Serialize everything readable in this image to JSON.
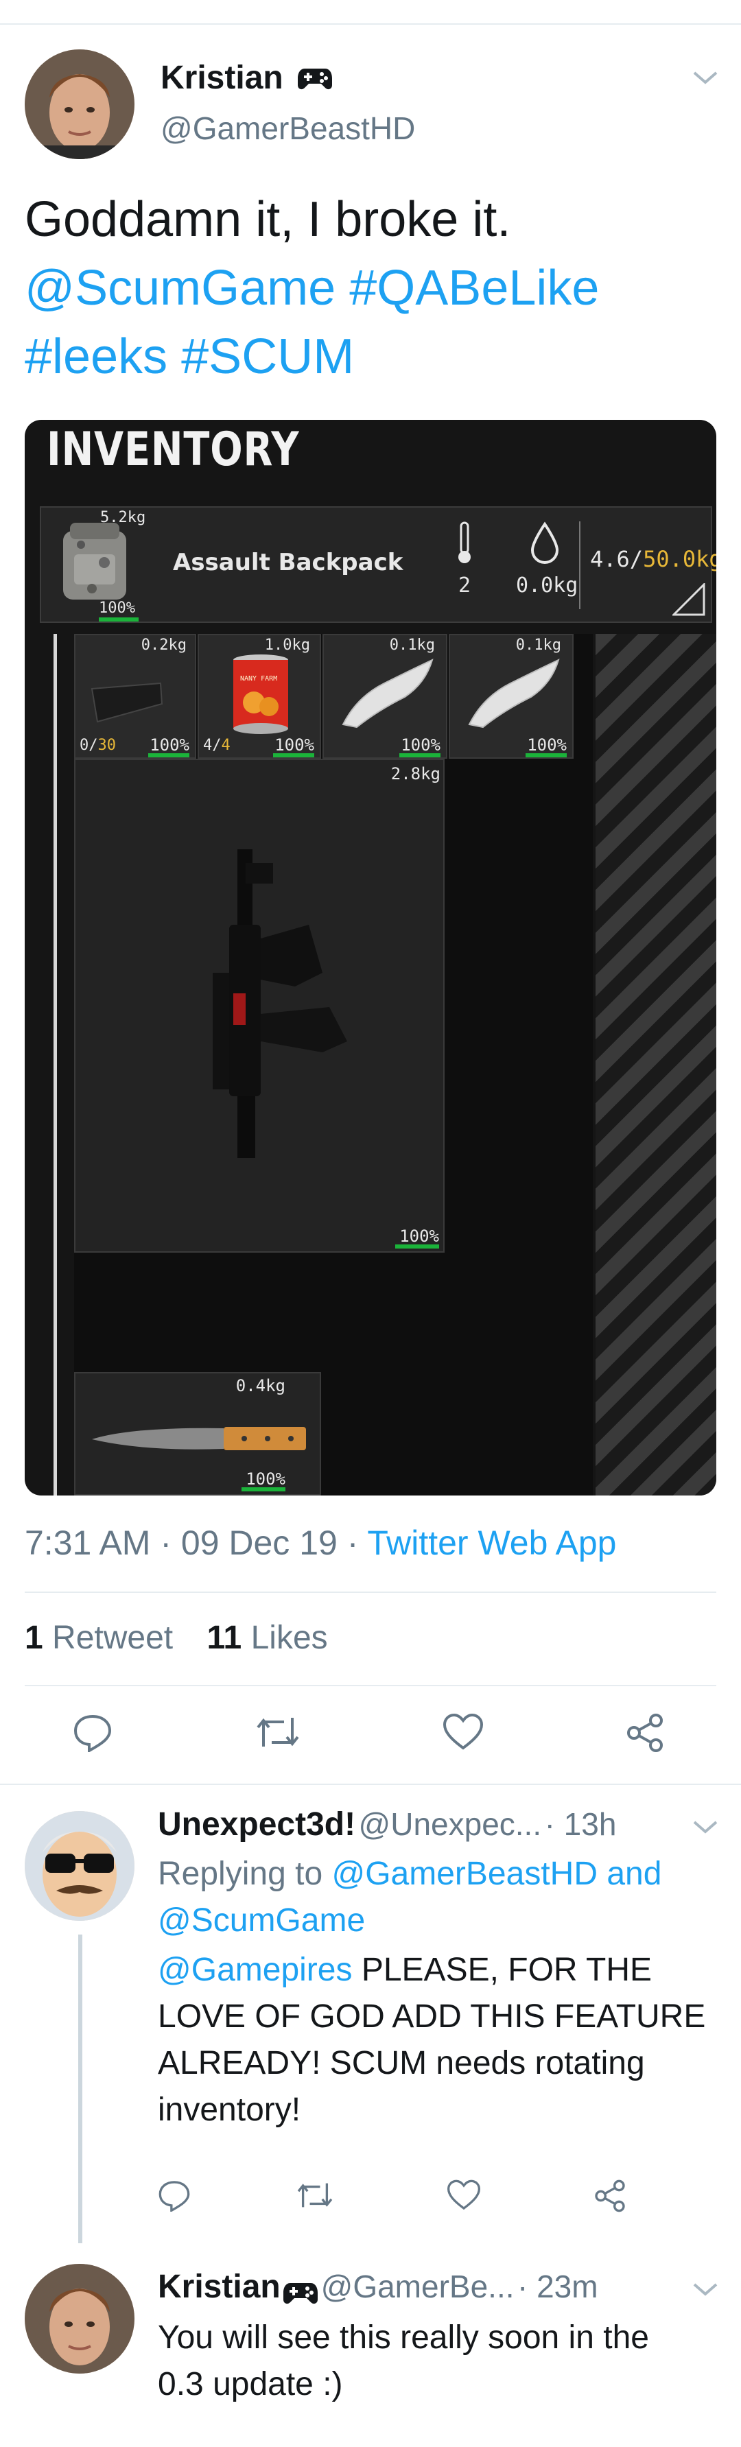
{
  "tweet": {
    "author_name": "Kristian",
    "author_handle": "@GamerBeastHD",
    "text_line1": "Goddamn it, I broke it.",
    "mention": "@ScumGame",
    "hashtag1": "#QABeLike",
    "hashtag2": "#leeks",
    "hashtag3": "#SCUM",
    "time": "7:31 AM · 09 Dec 19 · ",
    "source": "Twitter Web App",
    "retweets_count": "1",
    "retweets_label": "Retweet",
    "likes_count": "11",
    "likes_label": "Likes"
  },
  "game": {
    "title": "INVENTORY",
    "backpack": {
      "weight": "5.2kg",
      "condition": "100%",
      "name": "Assault Backpack",
      "temperature": "2",
      "water": "0.0kg",
      "capacity_used": "4.6",
      "capacity_max": "50.0kg"
    },
    "slots": [
      {
        "weight": "0.2kg",
        "left": "0",
        "left2": "30",
        "cond": "100%"
      },
      {
        "weight": "1.0kg",
        "left": "4",
        "left2": "4",
        "cond": "100%"
      },
      {
        "weight": "0.1kg",
        "cond": "100%"
      },
      {
        "weight": "0.1kg",
        "cond": "100%"
      }
    ],
    "weapon": {
      "weight": "2.8kg",
      "cond": "100%"
    },
    "knife": {
      "weight": "0.4kg",
      "cond": "100%"
    },
    "can_label": "NANY FARM"
  },
  "replies": [
    {
      "name": "Unexpect3d!",
      "handle": "@Unexpec...",
      "time": "· 13h",
      "replying_prefix": "Replying to ",
      "replying_targets": "@GamerBeastHD and",
      "replying_target2": "@ScumGame",
      "mention": "@Gamepires",
      "text1": " PLEASE, FOR THE",
      "text2": "LOVE OF GOD ADD THIS FEATURE",
      "text3": "ALREADY! SCUM needs rotating",
      "text4": "inventory!"
    },
    {
      "name": "Kristian",
      "handle": "@GamerBe...",
      "time": "· 23m",
      "text1": "You will see this really soon in the",
      "text2": "0.3 update :)"
    }
  ],
  "colors": {
    "link": "#1da1f2",
    "muted": "#657786",
    "capacity": "#e8b838",
    "bar": "#1bb33a"
  }
}
